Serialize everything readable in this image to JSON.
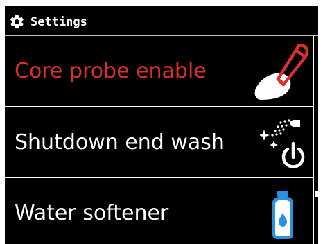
{
  "header": {
    "title": "Settings",
    "icon": "gear-icon"
  },
  "colors": {
    "background": "#000000",
    "text": "#ffffff",
    "active": "#d9302c",
    "accent_blue": "#2a90e0"
  },
  "menu": {
    "items": [
      {
        "label": "Core probe enable",
        "icon": "core-probe-icon",
        "active": true
      },
      {
        "label": "Shutdown end wash",
        "icon": "shutdown-wash-icon",
        "active": false
      },
      {
        "label": "Water softener",
        "icon": "water-softener-icon",
        "active": false
      }
    ]
  }
}
